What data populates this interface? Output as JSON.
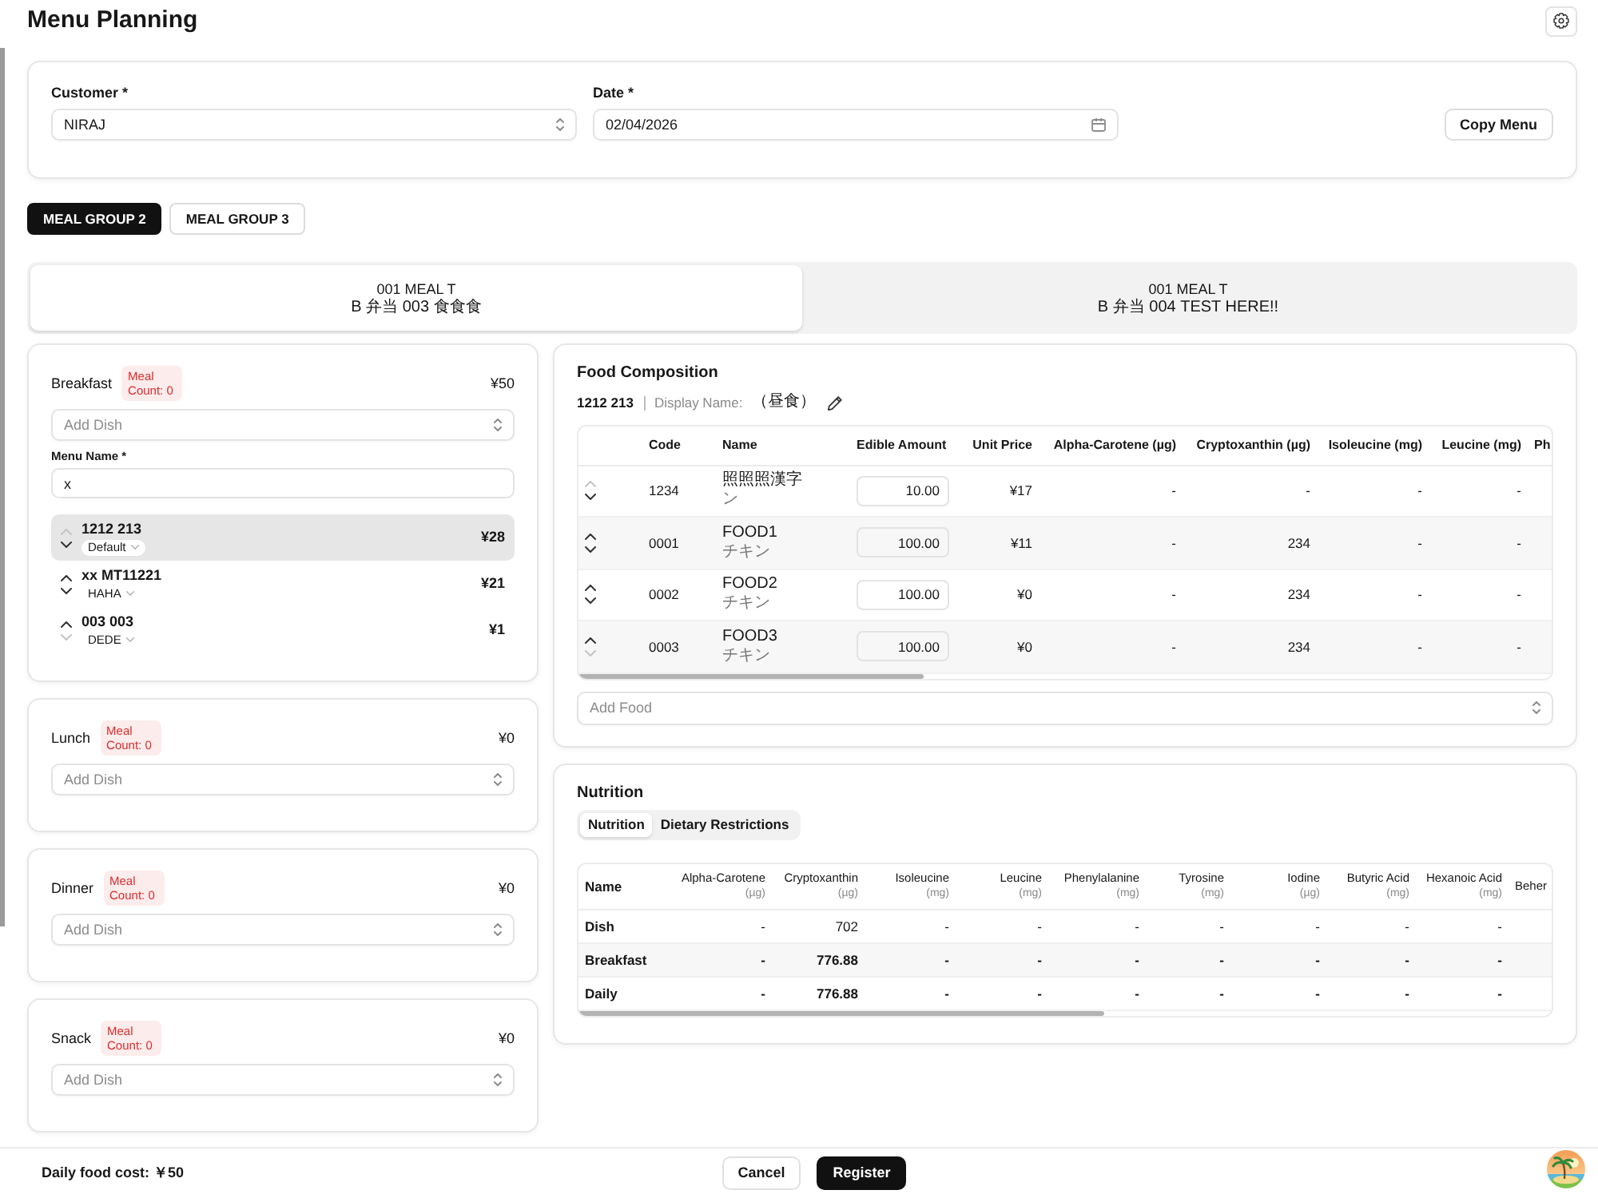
{
  "page": {
    "title": "Menu Planning"
  },
  "form": {
    "customer": {
      "label": "Customer *",
      "value": "NIRAJ"
    },
    "date": {
      "label": "Date *",
      "value": "02/04/2026"
    },
    "copy_button": "Copy Menu"
  },
  "meal_groups": [
    {
      "label": "MEAL GROUP 2",
      "selected": true
    },
    {
      "label": "MEAL GROUP 3",
      "selected": false
    }
  ],
  "meal_tabs": [
    {
      "line_1": "001 MEAL T",
      "line_2": "B 弁当 003 食食食",
      "selected": true
    },
    {
      "line_1": "001 MEAL T",
      "line_2": "B 弁当 004 TEST HERE!!",
      "selected": false
    }
  ],
  "meals": [
    {
      "name": "Breakfast",
      "badge": "Meal Count: 0",
      "cost": "¥50",
      "add_dish": {
        "placeholder": "Add Dish"
      },
      "menu_name": {
        "label": "Menu Name *",
        "value": "x"
      },
      "dishes": [
        {
          "name": "1212 213",
          "variant": "Default",
          "price": "¥28",
          "selected": true,
          "up_disabled": true,
          "down_disabled": false
        },
        {
          "name": "xx MT11221",
          "variant": "HAHA",
          "price": "¥21",
          "selected": false,
          "up_disabled": false,
          "down_disabled": false
        },
        {
          "name": "003 003",
          "variant": "DEDE",
          "price": "¥1",
          "selected": false,
          "up_disabled": false,
          "down_disabled": true
        }
      ]
    },
    {
      "name": "Lunch",
      "badge": "Meal Count: 0",
      "cost": "¥0",
      "add_dish": {
        "placeholder": "Add Dish"
      }
    },
    {
      "name": "Dinner",
      "badge": "Meal Count: 0",
      "cost": "¥0",
      "add_dish": {
        "placeholder": "Add Dish"
      }
    },
    {
      "name": "Snack",
      "badge": "Meal Count: 0",
      "cost": "¥0",
      "add_dish": {
        "placeholder": "Add Dish"
      }
    }
  ],
  "food_composition": {
    "title": "Food Composition",
    "dish": "1212 213",
    "display_label": "Display Name:",
    "display_name": "（昼食）",
    "columns": [
      "Code",
      "Name",
      "Edible Amount",
      "Unit Price",
      "Alpha-Carotene (µg)",
      "Cryptoxanthin (µg)",
      "Isoleucine (mg)",
      "Leucine (mg)",
      "Ph"
    ],
    "rows": [
      {
        "code": "1234",
        "name": "照照照漢字",
        "sub": "ン",
        "amount": "10.00",
        "unit_price": "¥17",
        "values": [
          "-",
          "-",
          "-",
          "-"
        ],
        "up_disabled": true,
        "down_disabled": false
      },
      {
        "code": "0001",
        "name": "FOOD1",
        "sub": "チキン",
        "amount": "100.00",
        "unit_price": "¥11",
        "values": [
          "-",
          "234",
          "-",
          "-"
        ],
        "up_disabled": false,
        "down_disabled": false
      },
      {
        "code": "0002",
        "name": "FOOD2",
        "sub": "チキン",
        "amount": "100.00",
        "unit_price": "¥0",
        "values": [
          "-",
          "234",
          "-",
          "-"
        ],
        "up_disabled": false,
        "down_disabled": false
      },
      {
        "code": "0003",
        "name": "FOOD3",
        "sub": "チキン",
        "amount": "100.00",
        "unit_price": "¥0",
        "values": [
          "-",
          "234",
          "-",
          "-"
        ],
        "up_disabled": false,
        "down_disabled": true
      }
    ],
    "add_food": {
      "placeholder": "Add Food"
    }
  },
  "nutrition": {
    "title": "Nutrition",
    "tabs": [
      {
        "label": "Nutrition",
        "selected": true
      },
      {
        "label": "Dietary Restrictions",
        "selected": false
      }
    ],
    "columns": [
      {
        "name": "Name"
      },
      {
        "name": "Alpha-Carotene",
        "unit": "(µg)"
      },
      {
        "name": "Cryptoxanthin",
        "unit": "(µg)"
      },
      {
        "name": "Isoleucine",
        "unit": "(mg)"
      },
      {
        "name": "Leucine",
        "unit": "(mg)"
      },
      {
        "name": "Phenylalanine",
        "unit": "(mg)"
      },
      {
        "name": "Tyrosine",
        "unit": "(mg)"
      },
      {
        "name": "Iodine",
        "unit": "(µg)"
      },
      {
        "name": "Butyric Acid",
        "unit": "(mg)"
      },
      {
        "name": "Hexanoic Acid",
        "unit": "(mg)"
      },
      {
        "name": "Beher"
      }
    ],
    "rows": [
      {
        "name": "Dish",
        "kind": "dish",
        "values": [
          "-",
          "702",
          "-",
          "-",
          "-",
          "-",
          "-",
          "-",
          "-"
        ]
      },
      {
        "name": "Breakfast",
        "kind": "total",
        "values": [
          "-",
          "776.88",
          "-",
          "-",
          "-",
          "-",
          "-",
          "-",
          "-"
        ]
      },
      {
        "name": "Daily",
        "kind": "total",
        "values": [
          "-",
          "776.88",
          "-",
          "-",
          "-",
          "-",
          "-",
          "-",
          "-"
        ]
      }
    ]
  },
  "footer": {
    "daily_cost": "Daily food cost: ￥50",
    "cancel": "Cancel",
    "register": "Register"
  }
}
